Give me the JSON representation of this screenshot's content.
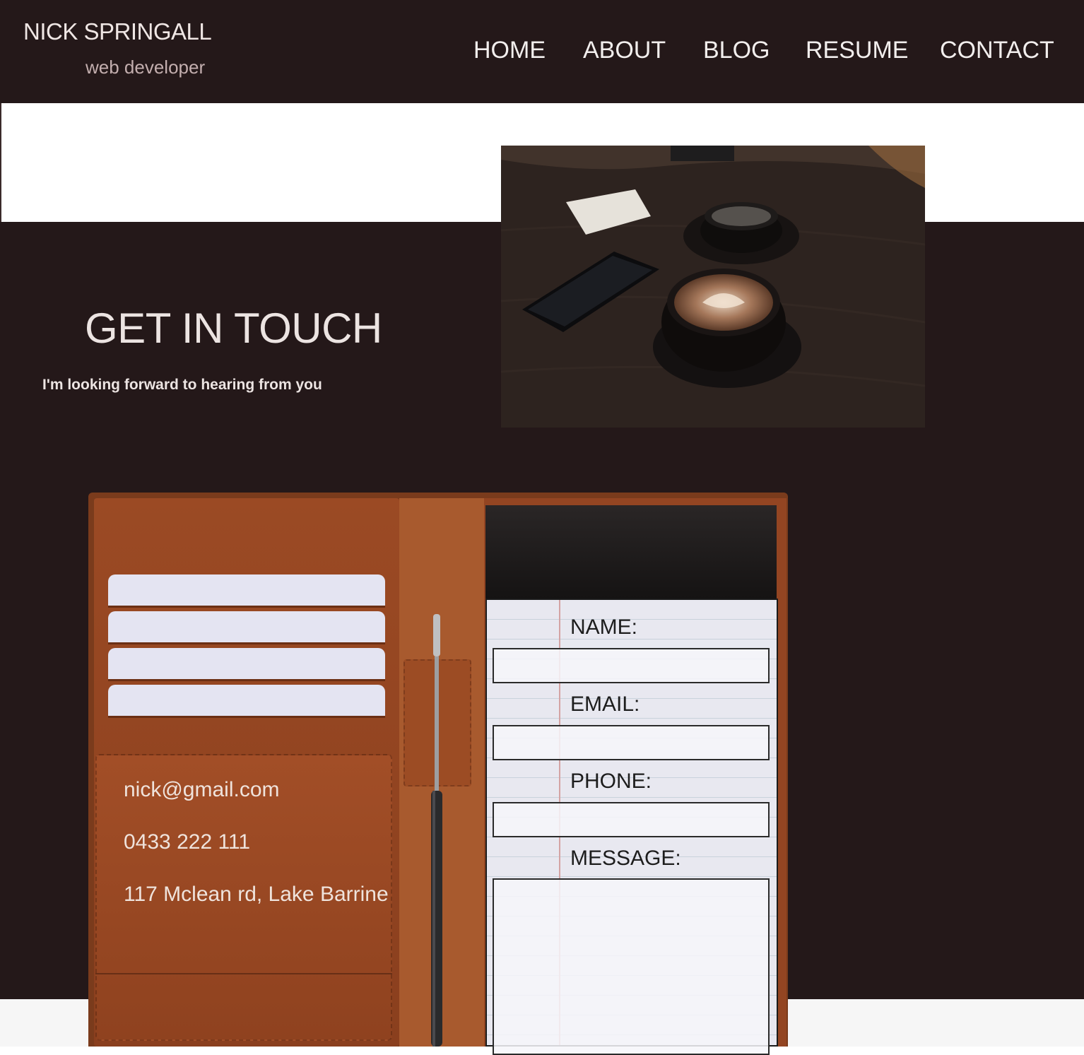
{
  "header": {
    "brand_name": "NICK SPRINGALL",
    "brand_tagline": "web developer",
    "nav": [
      {
        "label": "HOME"
      },
      {
        "label": "ABOUT"
      },
      {
        "label": "BLOG"
      },
      {
        "label": "RESUME"
      },
      {
        "label": "CONTACT"
      }
    ]
  },
  "hero": {
    "title": "GET IN TOUCH",
    "subtitle": "I'm looking forward to hearing from you",
    "photo_icon": "coffee-table-photo"
  },
  "contact_info": {
    "email": "nick@gmail.com",
    "phone": "0433 222 111",
    "address": "117 Mclean rd, Lake Barrine"
  },
  "form": {
    "name_label": "NAME:",
    "email_label": "EMAIL:",
    "phone_label": "PHONE:",
    "message_label": "MESSAGE:",
    "name_value": "",
    "email_value": "",
    "phone_value": "",
    "message_value": ""
  },
  "colors": {
    "background_dark": "#241819",
    "leather": "#934522",
    "notepad": "#e8e8f0"
  }
}
